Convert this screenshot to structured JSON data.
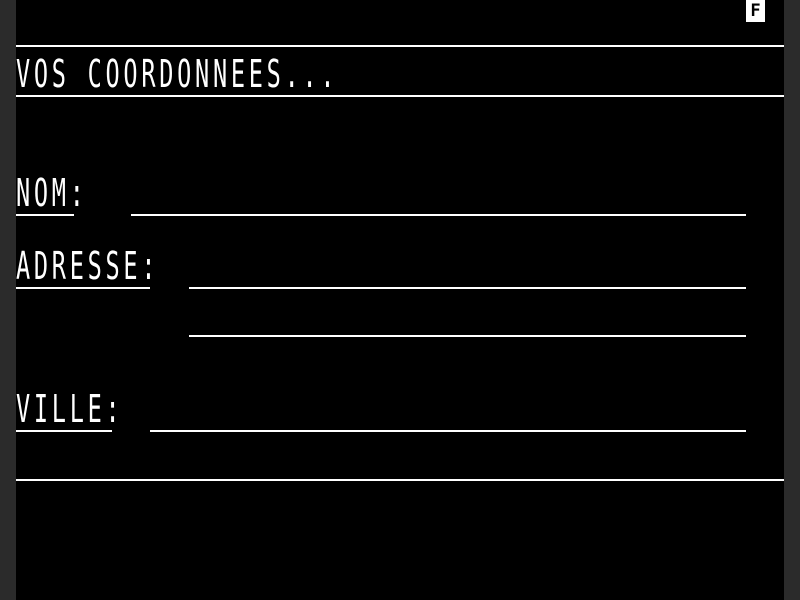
{
  "status_indicator": "F",
  "header": {
    "title": "VOS COORDONNEES..."
  },
  "form": {
    "nom_label": "NOM:",
    "adresse_label": "ADRESSE:",
    "ville_label": "VILLE:",
    "nom_value": "",
    "adresse_line1_value": "",
    "adresse_line2_value": "",
    "ville_value": ""
  },
  "colors": {
    "background": "#000000",
    "foreground": "#ffffff",
    "border": "#2b2b2b"
  }
}
